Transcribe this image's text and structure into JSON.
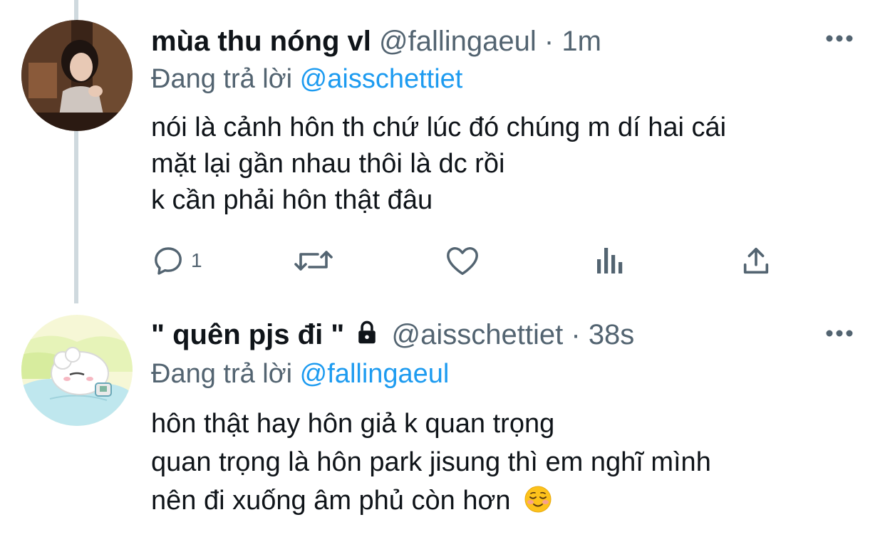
{
  "tweets": [
    {
      "display_name": "mùa thu nóng vl",
      "handle": "@fallingaeul",
      "separator": "·",
      "time": "1m",
      "reply_prefix": "Đang trả lời",
      "reply_to": "@aisschettiet",
      "body_lines": [
        "nói là cảnh hôn th chứ lúc đó chúng m dí hai cái",
        "mặt lại gần nhau thôi là dc rồi",
        "k cần phải hôn thật đâu"
      ],
      "reply_count": "1",
      "avatar": "photo-avatar"
    },
    {
      "display_name": "\" quên pjs đi \"",
      "protected": true,
      "handle": "@aisschettiet",
      "separator": "·",
      "time": "38s",
      "reply_prefix": "Đang trả lời",
      "reply_to": "@fallingaeul",
      "body_lines": [
        "hôn thật hay hôn giả k quan trọng",
        "quan trọng là hôn park jisung thì em nghĩ mình",
        "nên đi xuống âm phủ còn hơn"
      ],
      "trailing_emoji": "smiling-face-emoji",
      "avatar": "cartoon-avatar"
    }
  ],
  "icons": {
    "more": "more-icon",
    "reply": "reply-icon",
    "retweet": "retweet-icon",
    "like": "like-icon",
    "analytics": "analytics-icon",
    "share": "share-icon",
    "lock": "lock-icon"
  },
  "colors": {
    "text": "#0f1419",
    "secondary": "#536471",
    "link": "#1d9bf0",
    "thread_line": "#cfd9de"
  }
}
